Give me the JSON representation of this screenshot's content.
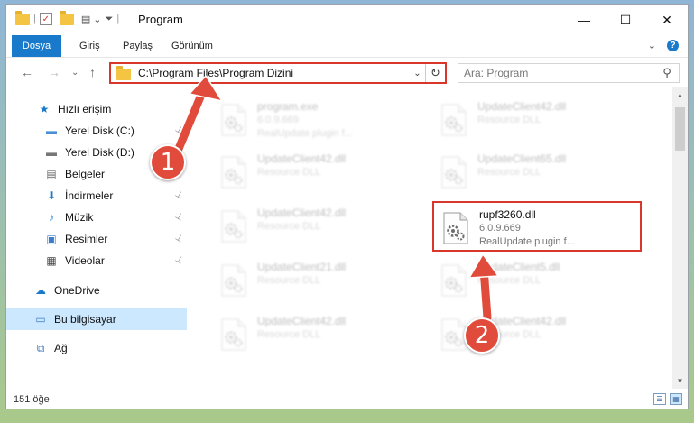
{
  "window": {
    "title": "Program",
    "controls": {
      "minimize": "—",
      "maximize": "☐",
      "close": "✕"
    }
  },
  "ribbon": {
    "tabs": [
      "Dosya",
      "Giriş",
      "Paylaş",
      "Görünüm"
    ],
    "help": "?",
    "expand": "⌄"
  },
  "nav": {
    "back": "←",
    "forward": "→",
    "recent": "⌄",
    "up": "↑",
    "address": "C:\\Program Files\\Program Dizini",
    "address_dropdown": "⌄",
    "refresh": "↻",
    "search_placeholder": "Ara: Program",
    "search_icon": "⚲"
  },
  "sidebar": {
    "items": [
      {
        "label": "Hızlı erişim",
        "icon": "star-icon",
        "glyph": "★",
        "color": "#1979ca",
        "pinned": false
      },
      {
        "label": "Yerel Disk (C:)",
        "icon": "drive-icon",
        "glyph": "▬",
        "color": "#4a8fd6",
        "pinned": true
      },
      {
        "label": "Yerel Disk (D:)",
        "icon": "drive-icon",
        "glyph": "▬",
        "color": "#777777",
        "pinned": true
      },
      {
        "label": "Belgeler",
        "icon": "document-icon",
        "glyph": "▤",
        "color": "#6a6a6a",
        "pinned": true
      },
      {
        "label": "İndirmeler",
        "icon": "download-icon",
        "glyph": "⬇",
        "color": "#1979ca",
        "pinned": true
      },
      {
        "label": "Müzik",
        "icon": "music-icon",
        "glyph": "♪",
        "color": "#1979ca",
        "pinned": true
      },
      {
        "label": "Resimler",
        "icon": "picture-icon",
        "glyph": "▣",
        "color": "#3d7cc9",
        "pinned": true
      },
      {
        "label": "Videolar",
        "icon": "video-icon",
        "glyph": "▦",
        "color": "#444444",
        "pinned": true
      },
      {
        "label": "OneDrive",
        "icon": "cloud-icon",
        "glyph": "☁",
        "color": "#1979ca",
        "pinned": false
      },
      {
        "label": "Bu bilgisayar",
        "icon": "computer-icon",
        "glyph": "▭",
        "color": "#3d7cc9",
        "pinned": false
      },
      {
        "label": "Ağ",
        "icon": "network-icon",
        "glyph": "⧉",
        "color": "#3d7cc9",
        "pinned": false
      }
    ],
    "pin_glyph": "📌"
  },
  "files": [
    {
      "name": "program.exe",
      "meta1": "6.0.9.669",
      "meta2": "RealUpdate plugin f...",
      "blurred": true
    },
    {
      "name": "UpdateClient42.dll",
      "meta1": "Resource DLL",
      "meta2": "",
      "blurred": true
    },
    {
      "name": "UpdateClient42.dll",
      "meta1": "Resource DLL",
      "meta2": "",
      "blurred": true
    },
    {
      "name": "UpdateClient65.dll",
      "meta1": "Resource DLL",
      "meta2": "",
      "blurred": true
    },
    {
      "name": "UpdateClient42.dll",
      "meta1": "Resource DLL",
      "meta2": "",
      "blurred": true
    },
    {
      "name": "rupf3260.dll",
      "meta1": "6.0.9.669",
      "meta2": "RealUpdate plugin f...",
      "blurred": false
    },
    {
      "name": "UpdateClient21.dll",
      "meta1": "Resource DLL",
      "meta2": "",
      "blurred": true
    },
    {
      "name": "UpdateClient5.dll",
      "meta1": "Resource DLL",
      "meta2": "",
      "blurred": true
    },
    {
      "name": "UpdateClient42.dll",
      "meta1": "Resource DLL",
      "meta2": "",
      "blurred": true
    },
    {
      "name": "UpdateClient42.dll",
      "meta1": "Resource DLL",
      "meta2": "",
      "blurred": true
    }
  ],
  "status": {
    "count": "151 öğe"
  },
  "annotations": {
    "badge1": "1",
    "badge2": "2",
    "color": "#e14b3b"
  }
}
